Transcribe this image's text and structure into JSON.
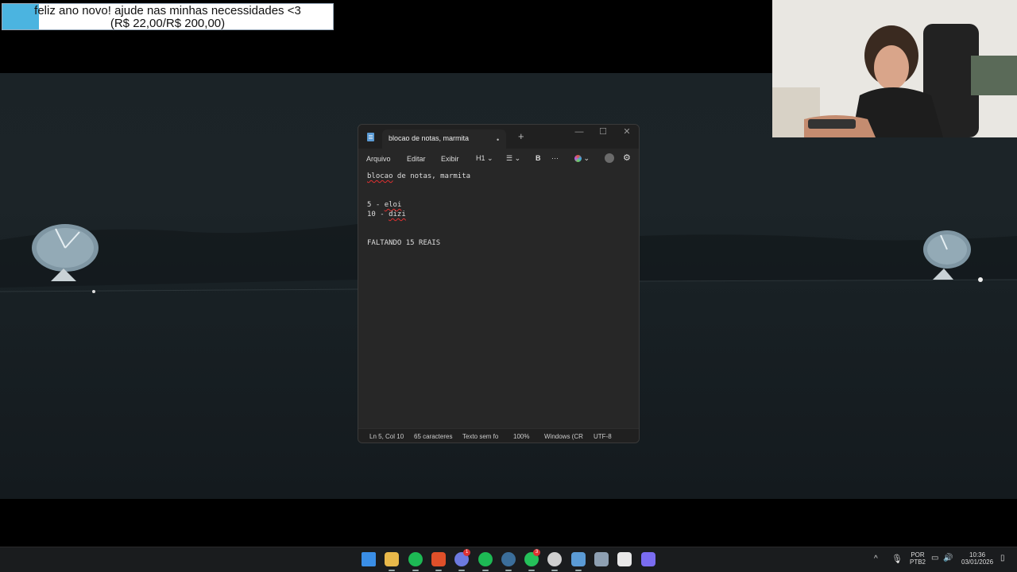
{
  "overlay": {
    "donation_line1": "feliz ano novo! ajude nas minhas necessidades <3",
    "donation_line2": "(R$ 22,00/R$ 200,00)",
    "donation_progress": 0.11,
    "progress_color": "#4bb4e0"
  },
  "window": {
    "tab_title": "blocao de notas, marmita",
    "tab_modified_indicator": "•",
    "new_tab": "+",
    "minimize": "—",
    "maximize": "☐",
    "close": "✕"
  },
  "menu": {
    "items": [
      "Arquivo",
      "Editar",
      "Exibir"
    ],
    "heading": "H1",
    "bold": "B",
    "more": "···"
  },
  "document": {
    "lines": [
      "blocao de notas, marmita",
      "",
      "",
      "5 - eloi",
      "10 - dizi",
      "",
      "",
      "FALTANDO 15 REAIS"
    ]
  },
  "status": {
    "position": "Ln 5, Col 10",
    "chars": "65 caracteres",
    "format": "Texto sem fo",
    "zoom": "100%",
    "line_ending": "Windows (CR",
    "encoding": "UTF-8"
  },
  "taskbar": {
    "apps": [
      {
        "name": "start-icon",
        "color": "#3a8ee6"
      },
      {
        "name": "file-explorer-icon",
        "color": "#e8b84a"
      },
      {
        "name": "spotify-icon",
        "color": "#1db954"
      },
      {
        "name": "brave-icon",
        "color": "#e0502a"
      },
      {
        "name": "discord-icon",
        "color": "#6c7ae0",
        "badge": "1"
      },
      {
        "name": "spotify-icon-2",
        "color": "#1db954"
      },
      {
        "name": "steam-icon",
        "color": "#3b6e9a"
      },
      {
        "name": "whatsapp-icon",
        "color": "#25c15a",
        "badge": "3"
      },
      {
        "name": "obs-icon",
        "color": "#cfcfcf"
      },
      {
        "name": "notepad-icon",
        "color": "#5b9bd5"
      },
      {
        "name": "calculator-icon",
        "color": "#8ea0b2"
      },
      {
        "name": "capcut-icon",
        "color": "#e8e8e8"
      },
      {
        "name": "app-diamond-icon",
        "color": "#7a6cf0"
      }
    ],
    "language": "POR",
    "layout": "PTB2",
    "time": "10:36",
    "date": "03/01/2026"
  }
}
